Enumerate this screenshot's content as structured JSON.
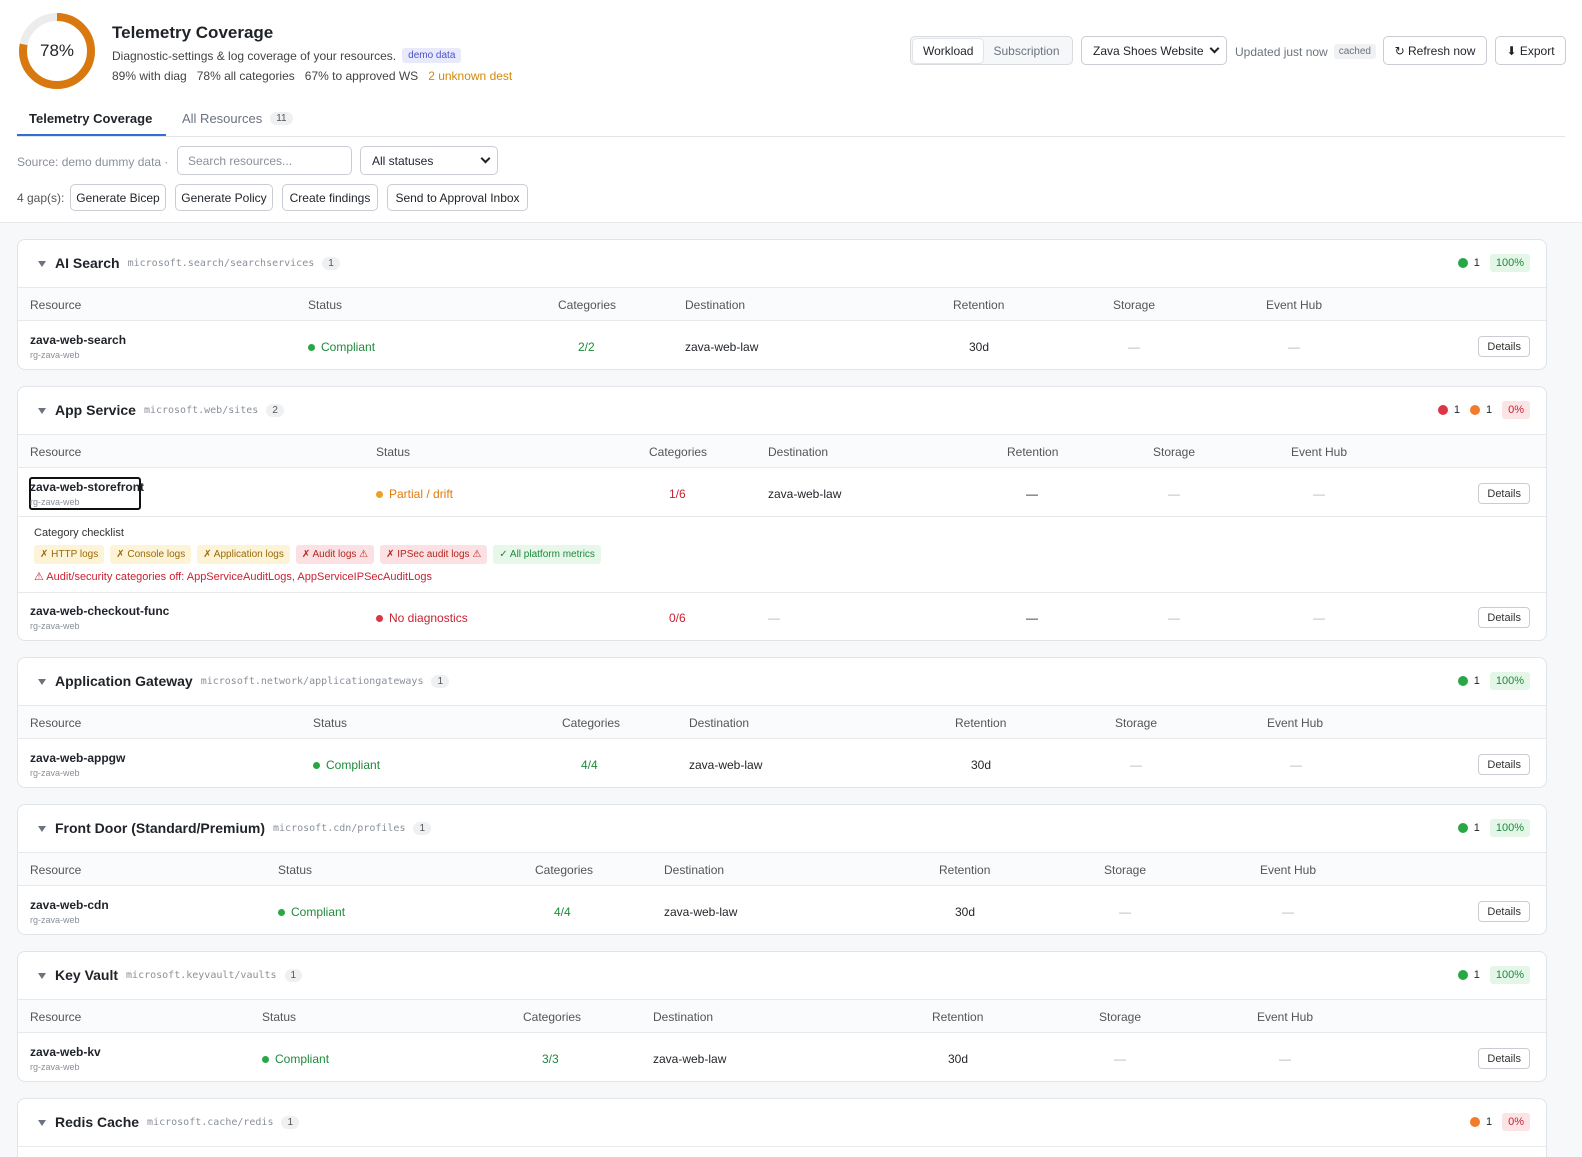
{
  "header": {
    "coverage_pct": 0.78,
    "coverage_label": "78%",
    "title": "Telemetry Coverage",
    "subtitle": "Diagnostic-settings & log coverage of your resources.",
    "demo_badge": "demo data",
    "stats": [
      "89% with diag",
      "78% all categories",
      "67% to approved WS"
    ],
    "warn_stat": "2 unknown dest",
    "scope": {
      "options": [
        "Workload",
        "Subscription"
      ],
      "selected": "Workload"
    },
    "workload_select": "Zava Shoes Website",
    "updated": "Updated just now",
    "cached_badge": "cached",
    "refresh_label": "↻ Refresh now",
    "export_label": "⬇ Export"
  },
  "tabs": [
    {
      "label": "Telemetry Coverage",
      "active": true
    },
    {
      "label": "All Resources",
      "count": "11",
      "active": false
    }
  ],
  "filters": {
    "source": "Source: demo dummy data ·",
    "search_placeholder": "Search resources...",
    "status_select": "All statuses"
  },
  "actions": {
    "gaps": "4 gap(s):",
    "buttons": [
      "Generate Bicep",
      "Generate Policy",
      "Create findings",
      "Send to Approval Inbox"
    ]
  },
  "columns": [
    "Resource",
    "Status",
    "Categories",
    "Destination",
    "Retention",
    "Storage",
    "Event Hub"
  ],
  "empty": "—",
  "details_label": "Details",
  "groups": [
    {
      "name": "AI Search",
      "type": "microsoft.search/searchservices",
      "count": "1",
      "summary": [
        {
          "color": "#28a745",
          "n": "1"
        }
      ],
      "pct": "100%",
      "rows": [
        {
          "name": "zava-web-search",
          "rg": "rg-zava-web",
          "status": "Compliant",
          "cats": "2/2",
          "dest": "zava-web-law",
          "ret": "30d"
        }
      ]
    },
    {
      "name": "App Service",
      "type": "microsoft.web/sites",
      "count": "2",
      "summary": [
        {
          "color": "#dc3545",
          "n": "1"
        },
        {
          "color": "#f27b2c",
          "n": "1"
        }
      ],
      "pct": "0%",
      "rows": [
        {
          "name": "zava-web-storefront",
          "rg": "rg-zava-web",
          "status": "Partial / drift",
          "cats": "1/6",
          "dest": "zava-web-law",
          "ret": "—"
        },
        {
          "name": "zava-web-checkout-func",
          "rg": "rg-zava-web",
          "status": "No diagnostics",
          "cats": "0/6",
          "dest": "—",
          "ret": "—"
        }
      ],
      "checklist": {
        "title": "Category checklist",
        "items": [
          "✗ HTTP logs",
          "✗ Console logs",
          "✗ Application logs",
          "✗ Audit logs ⚠",
          "✗ IPSec audit logs ⚠",
          "✓ All platform metrics"
        ],
        "alert": "⚠ Audit/security categories off: AppServiceAuditLogs, AppServiceIPSecAuditLogs"
      }
    },
    {
      "name": "Application Gateway",
      "type": "microsoft.network/applicationgateways",
      "count": "1",
      "summary": [
        {
          "color": "#28a745",
          "n": "1"
        }
      ],
      "pct": "100%",
      "rows": [
        {
          "name": "zava-web-appgw",
          "rg": "rg-zava-web",
          "status": "Compliant",
          "cats": "4/4",
          "dest": "zava-web-law",
          "ret": "30d"
        }
      ]
    },
    {
      "name": "Front Door (Standard/Premium)",
      "type": "microsoft.cdn/profiles",
      "count": "1",
      "summary": [
        {
          "color": "#28a745",
          "n": "1"
        }
      ],
      "pct": "100%",
      "rows": [
        {
          "name": "zava-web-cdn",
          "rg": "rg-zava-web",
          "status": "Compliant",
          "cats": "4/4",
          "dest": "zava-web-law",
          "ret": "30d"
        }
      ]
    },
    {
      "name": "Key Vault",
      "type": "microsoft.keyvault/vaults",
      "count": "1",
      "summary": [
        {
          "color": "#28a745",
          "n": "1"
        }
      ],
      "pct": "100%",
      "rows": [
        {
          "name": "zava-web-kv",
          "rg": "rg-zava-web",
          "status": "Compliant",
          "cats": "3/3",
          "dest": "zava-web-law",
          "ret": "30d"
        }
      ]
    },
    {
      "name": "Redis Cache",
      "type": "microsoft.cache/redis",
      "count": "1",
      "summary": [
        {
          "color": "#f27b2c",
          "n": "1"
        }
      ],
      "pct": "0%",
      "rows": []
    }
  ]
}
